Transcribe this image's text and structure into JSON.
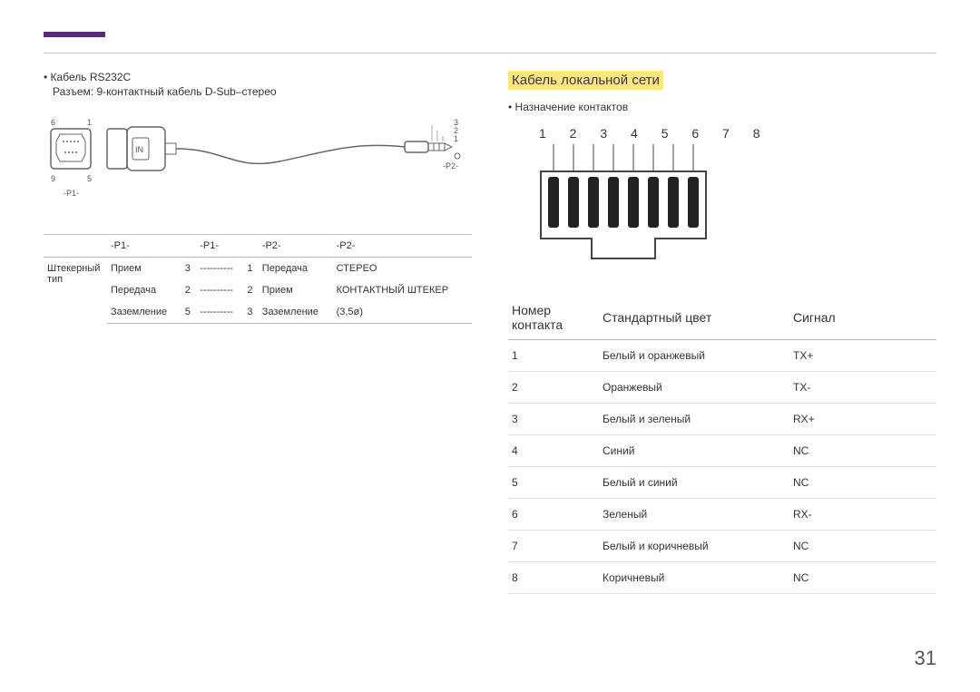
{
  "page_number": "31",
  "left": {
    "cable_title": "Кабель RS232C",
    "connector_desc": "Разъем: 9-контактный кабель D-Sub–стерео",
    "diag": {
      "p1_label": "-P1-",
      "p2_label": "-P2-",
      "pin6": "6",
      "pin1": "1",
      "pin9": "9",
      "pin5": "5",
      "ring3": "3",
      "ring2": "2",
      "ring1": "1",
      "in_label": "IN"
    },
    "headers": {
      "c1": "-P1-",
      "c2": "-P1-",
      "c3": "-P2-",
      "c4": "-P2-"
    },
    "rowlabel": "Штекерный тип",
    "rows": [
      {
        "a": "Прием",
        "b": "3",
        "dash": "----------",
        "c": "1",
        "d": "Передача",
        "e": "СТЕРЕО"
      },
      {
        "a": "Передача",
        "b": "2",
        "dash": "----------",
        "c": "2",
        "d": "Прием",
        "e": "КОНТАКТНЫЙ ШТЕКЕР"
      },
      {
        "a": "Заземление",
        "b": "5",
        "dash": "----------",
        "c": "3",
        "d": "Заземление",
        "e": "(3,5ø)"
      }
    ]
  },
  "right": {
    "heading": "Кабель локальной сети",
    "bullet": "Назначение контактов",
    "pins": "1 2 3 4 5 6 7 8",
    "headers": {
      "num": "Номер контакта",
      "color": "Стандартный цвет",
      "signal": "Сигнал"
    },
    "rows": [
      {
        "n": "1",
        "color": "Белый и оранжевый",
        "sig": "TX+"
      },
      {
        "n": "2",
        "color": "Оранжевый",
        "sig": "TX-"
      },
      {
        "n": "3",
        "color": "Белый и зеленый",
        "sig": "RX+"
      },
      {
        "n": "4",
        "color": "Синий",
        "sig": "NC"
      },
      {
        "n": "5",
        "color": "Белый и синий",
        "sig": "NC"
      },
      {
        "n": "6",
        "color": "Зеленый",
        "sig": "RX-"
      },
      {
        "n": "7",
        "color": "Белый и коричневый",
        "sig": "NC"
      },
      {
        "n": "8",
        "color": "Коричневый",
        "sig": "NC"
      }
    ]
  }
}
